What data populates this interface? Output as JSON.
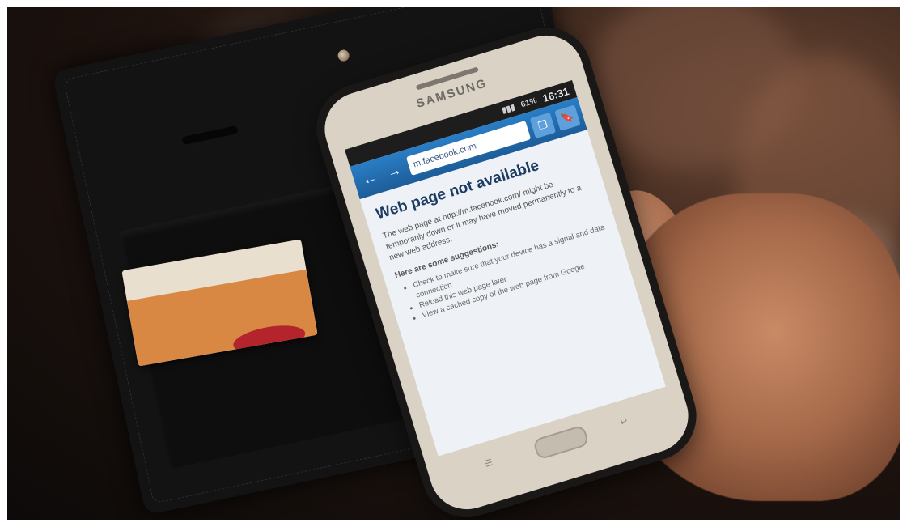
{
  "scene": {
    "description_colors": {
      "background": "#1c120e",
      "toolbar": "#1d5d99",
      "card_band": "#d98843"
    }
  },
  "phone": {
    "brand": "SAMSUNG",
    "status": {
      "time": "16:31",
      "battery": "61%"
    },
    "browser": {
      "url": "m.facebook.com",
      "back_icon": "arrow-left-icon",
      "forward_icon": "arrow-right-icon",
      "tabs_icon": "windows-icon",
      "bookmark_icon": "bookmark-icon"
    },
    "page": {
      "title": "Web page not available",
      "body": "The web page at http://m.facebook.com/ might be temporarily down or it may have moved permanently to a new web address.",
      "suggestions_heading": "Here are some suggestions:",
      "suggestions": [
        "Check to make sure that your device has a signal and data connection",
        "Reload this web page later",
        "View a cached copy of the web page from Google"
      ]
    }
  }
}
